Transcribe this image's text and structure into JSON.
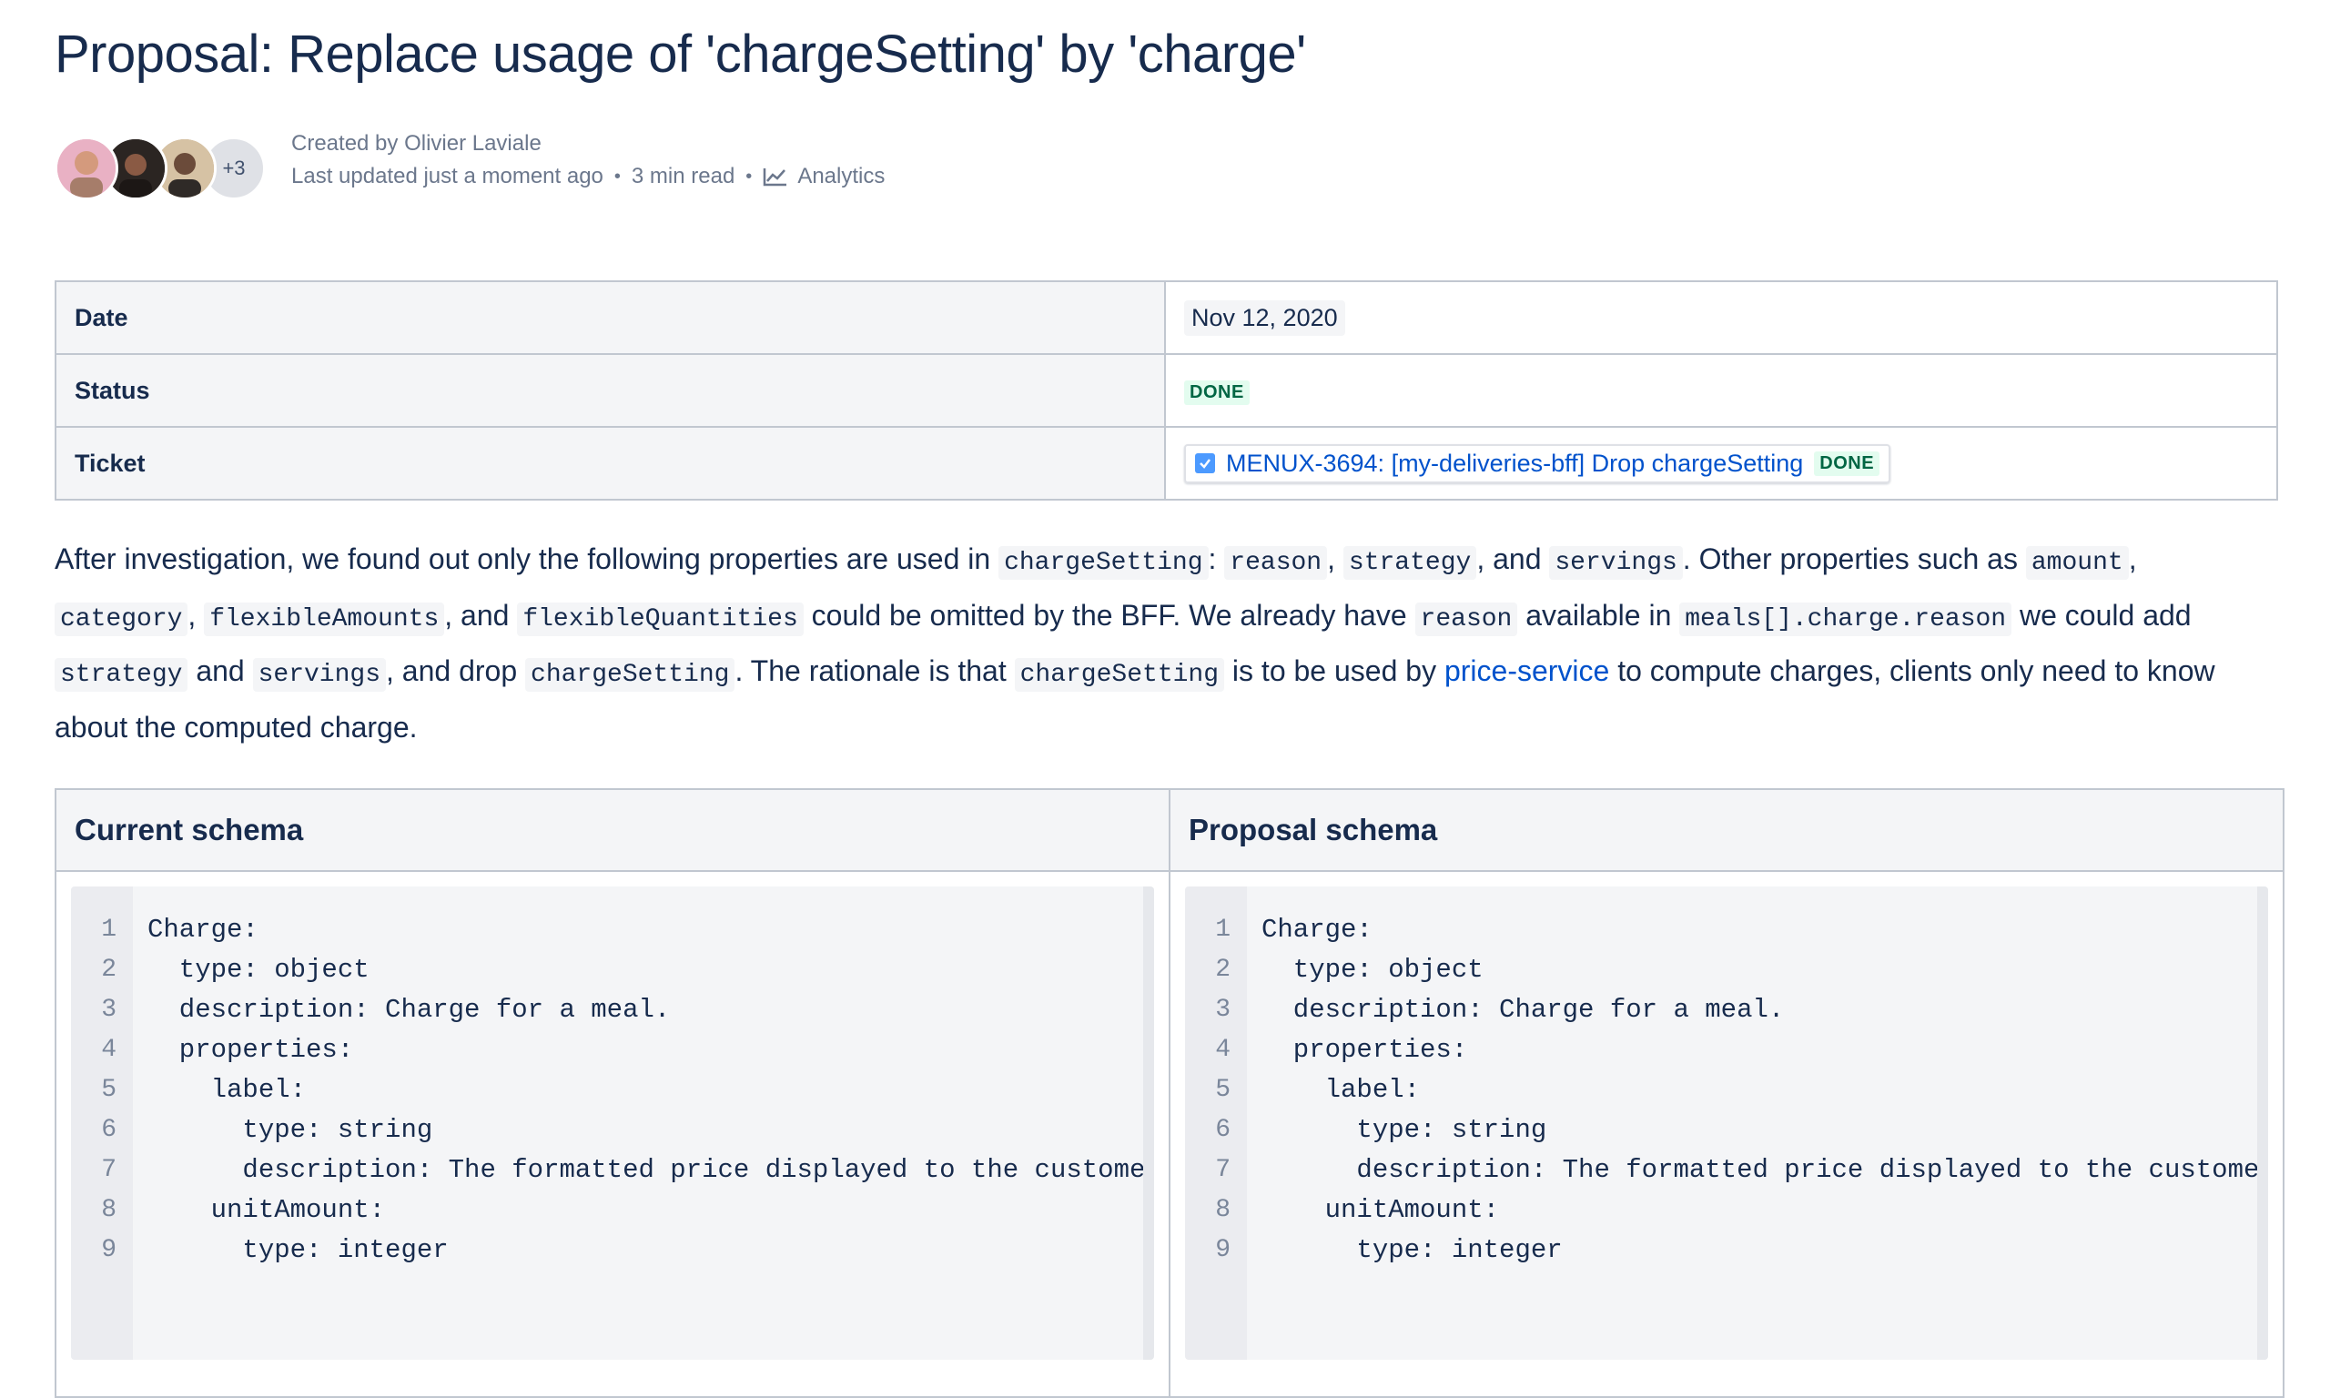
{
  "page": {
    "title": "Proposal: Replace usage of 'chargeSetting' by 'charge'"
  },
  "byline": {
    "created_by": "Created by Olivier Laviale",
    "last_updated": "Last updated just a moment ago",
    "read_time": "3 min read",
    "analytics_label": "Analytics",
    "more_contributors": "+3",
    "icons": [
      "avatar",
      "analytics-icon"
    ]
  },
  "info_table": {
    "rows": [
      {
        "key": "Date",
        "value": "Nov 12, 2020"
      },
      {
        "key": "Status",
        "value": "DONE"
      },
      {
        "key": "Ticket",
        "value": "MENUX-3694: [my-deliveries-bff] Drop chargeSetting",
        "badge": "DONE"
      }
    ],
    "colors": {
      "done_bg": "#e3fcef",
      "done_text": "#006644",
      "link": "#0052cc"
    }
  },
  "paragraph": {
    "t1": "After investigation, we found out only the following properties are used in ",
    "c1": "chargeSetting",
    "t2": ": ",
    "c2": "reason",
    "t3": ", ",
    "c3": "strategy",
    "t4": ", and ",
    "c4": "servings",
    "t5": ". Other properties such as ",
    "c5": "amount",
    "t6": ", ",
    "c6": "category",
    "t7": ", ",
    "c7": "flexibleAmounts",
    "t8": ", and ",
    "c8": "flexibleQuantities",
    "t9": " could be omitted by the BFF. We already have ",
    "c9": "reason",
    "t10": " available in ",
    "c10": "meals[].charge.reason",
    "t11": " we could add ",
    "c11": "strategy",
    "t12": " and ",
    "c12": "servings",
    "t13": ", and drop ",
    "c13": "chargeSetting",
    "t14": ". The rationale is that ",
    "c14": "chargeSetting",
    "t15": " is to be used by ",
    "link": "price-service",
    "t16": " to compute charges, clients only need to know about the computed charge."
  },
  "schema_table": {
    "current_header": "Current schema",
    "proposal_header": "Proposal schema",
    "line_numbers": [
      "1",
      "2",
      "3",
      "4",
      "5",
      "6",
      "7",
      "8",
      "9"
    ],
    "current_code": "Charge:\n  type: object\n  description: Charge for a meal.\n  properties:\n    label:\n      type: string\n      description: The formatted price displayed to the customer.\n    unitAmount:\n      type: integer",
    "proposal_code": "Charge:\n  type: object\n  description: Charge for a meal.\n  properties:\n    label:\n      type: string\n      description: The formatted price displayed to the customer.\n    unitAmount:\n      type: integer"
  }
}
